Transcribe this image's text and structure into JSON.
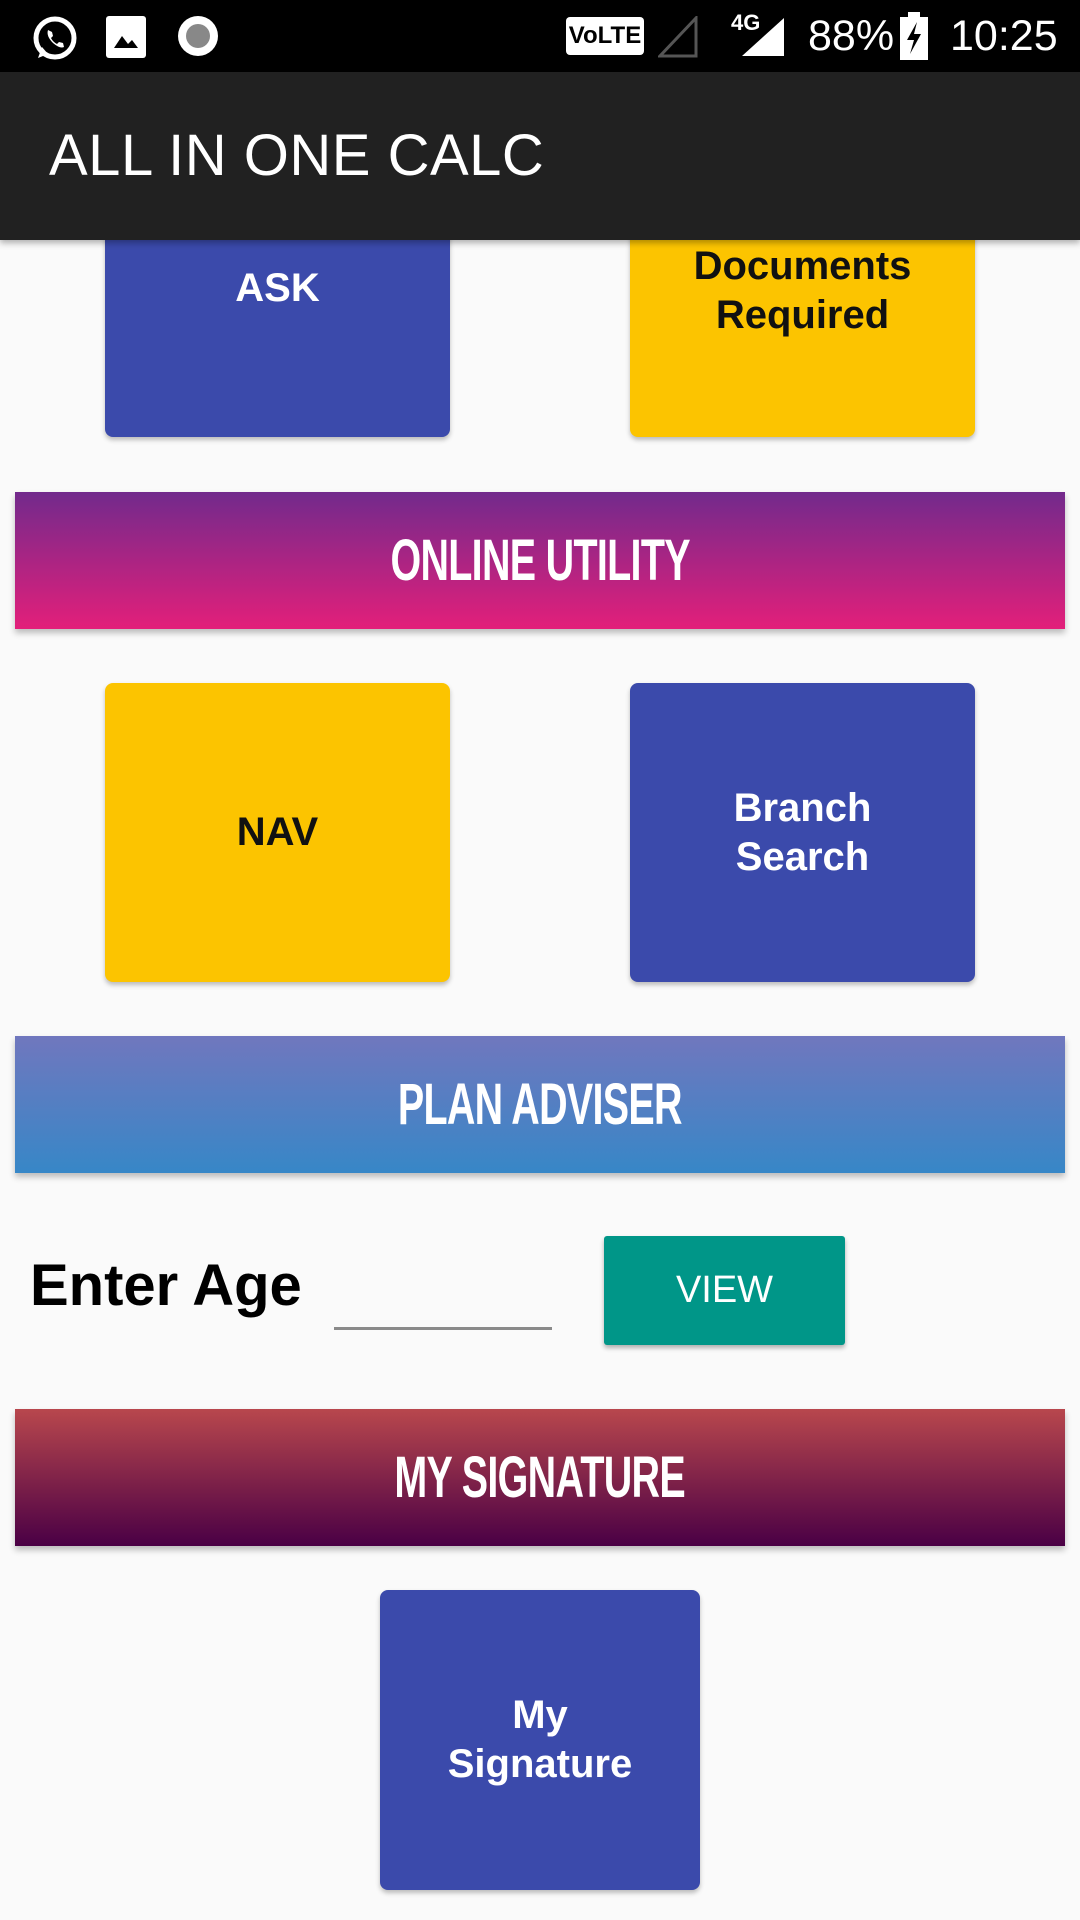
{
  "status_bar": {
    "volte": "VoLTE",
    "network": "4G",
    "battery": "88%",
    "time": "10:25",
    "icons": [
      "whatsapp-icon",
      "image-icon",
      "record-icon",
      "signal-icon",
      "battery-charging-icon"
    ]
  },
  "app_bar": {
    "title": "ALL IN ONE CALC"
  },
  "tiles_top": [
    {
      "label": "ASK",
      "color": "#3b4aab"
    },
    {
      "label_line1": "Documents",
      "label_line2": "Required",
      "color": "#fcc400"
    }
  ],
  "sections": {
    "online_utility": "ONLINE UTILITY",
    "plan_adviser": "PLAN ADVISER",
    "my_signature": "MY SIGNATURE"
  },
  "online_utility": {
    "nav": "NAV",
    "branch_line1": "Branch",
    "branch_line2": "Search"
  },
  "plan_adviser": {
    "label": "Enter Age",
    "age_value": "",
    "view_button": "VIEW",
    "button_color": "#009688"
  },
  "my_signature": {
    "line1": "My",
    "line2": "Signature"
  }
}
